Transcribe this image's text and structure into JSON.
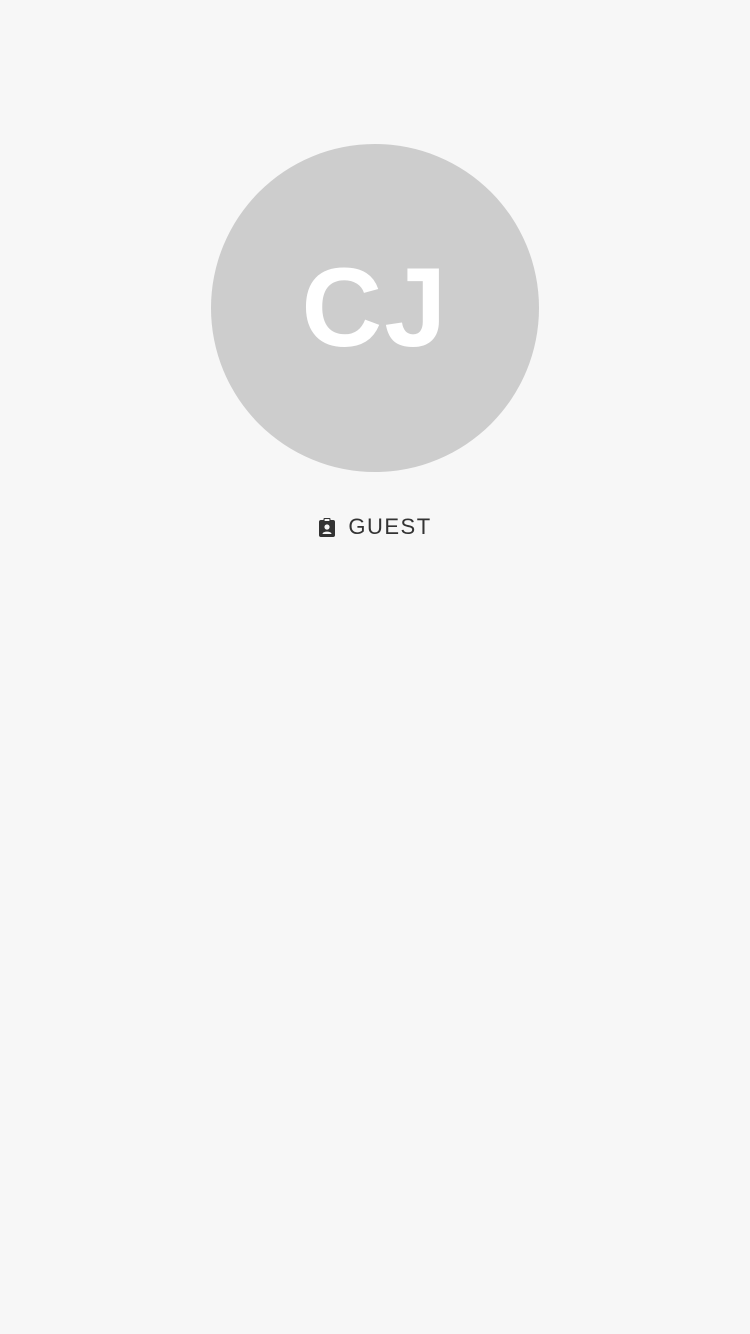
{
  "profile": {
    "initials": "CJ",
    "role": "GUEST",
    "role_icon": "badge-icon"
  },
  "colors": {
    "background": "#f7f7f7",
    "avatar_bg": "#cdcdcd",
    "avatar_text": "#ffffff",
    "role_text": "#333333"
  }
}
